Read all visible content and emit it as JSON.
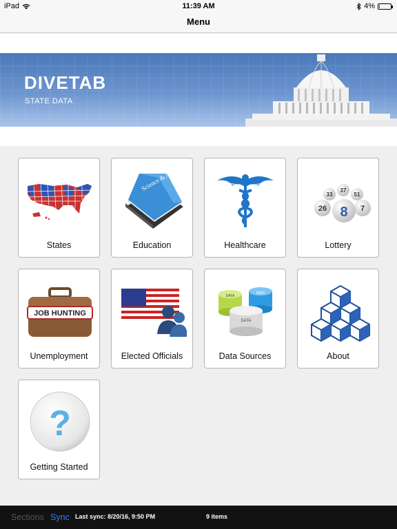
{
  "status": {
    "device": "iPad",
    "time": "11:39 AM",
    "battery": "4%",
    "battery_level": 0.04
  },
  "nav": {
    "title": "Menu"
  },
  "banner": {
    "brand": "DIVETAB",
    "subtitle": "STATE DATA"
  },
  "tiles": [
    {
      "label": "States",
      "icon": "us-map-icon"
    },
    {
      "label": "Education",
      "icon": "book-icon"
    },
    {
      "label": "Healthcare",
      "icon": "caduceus-icon"
    },
    {
      "label": "Lottery",
      "icon": "lottery-balls-icon"
    },
    {
      "label": "Unemployment",
      "icon": "job-hunting-briefcase-icon"
    },
    {
      "label": "Elected Officials",
      "icon": "flag-officials-icon"
    },
    {
      "label": "Data Sources",
      "icon": "data-cylinders-icon"
    },
    {
      "label": "About",
      "icon": "cubes-icon"
    },
    {
      "label": "Getting Started",
      "icon": "question-icon"
    }
  ],
  "icon_text": {
    "book": "Science & Art",
    "briefcase": "JOB HUNTING",
    "data": "DATA",
    "balls": [
      "33",
      "37",
      "51",
      "26",
      "8",
      "7"
    ]
  },
  "toolbar": {
    "sections": "Sections",
    "sync": "Sync",
    "last_sync": "Last sync: 8/20/16, 9:50 PM",
    "count": "9 items"
  },
  "colors": {
    "accent": "#2d7df6",
    "banner": "#5a86c4",
    "toolbar": "#121212"
  }
}
